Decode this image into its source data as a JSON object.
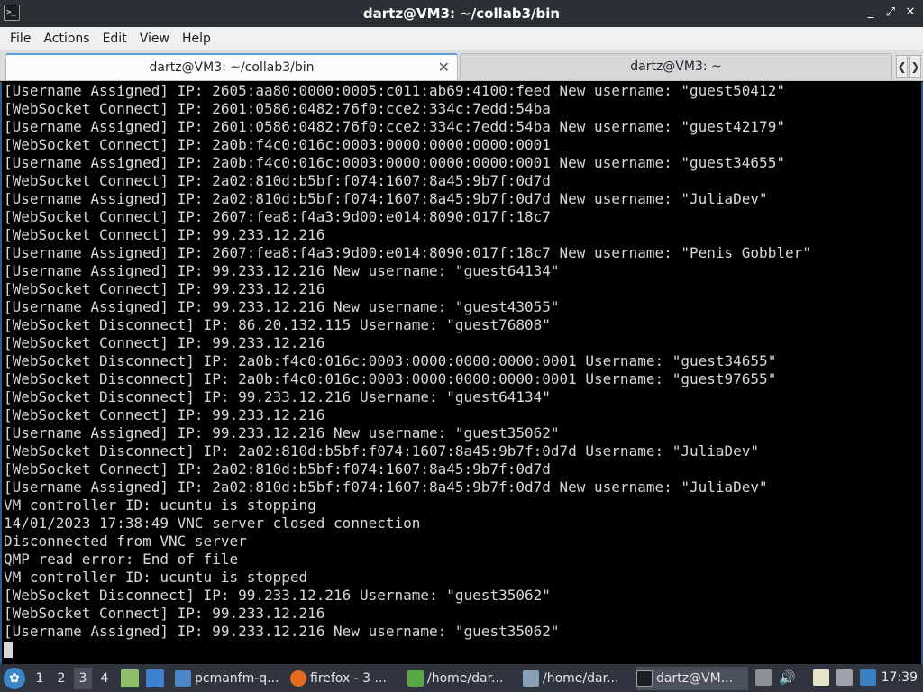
{
  "window": {
    "title": "dartz@VM3: ~/collab3/bin",
    "app_icon": ">_",
    "buttons": [
      "_",
      "⤢",
      "✕"
    ]
  },
  "menu": [
    "File",
    "Actions",
    "Edit",
    "View",
    "Help"
  ],
  "tabs": [
    {
      "label": "dartz@VM3: ~/collab3/bin",
      "active": true
    },
    {
      "label": "dartz@VM3: ~",
      "active": false
    }
  ],
  "terminal": {
    "lines": [
      "[Username Assigned] IP: 2605:aa80:0000:0005:c011:ab69:4100:feed New username: \"guest50412\"",
      "[WebSocket Connect] IP: 2601:0586:0482:76f0:cce2:334c:7edd:54ba",
      "[Username Assigned] IP: 2601:0586:0482:76f0:cce2:334c:7edd:54ba New username: \"guest42179\"",
      "[WebSocket Connect] IP: 2a0b:f4c0:016c:0003:0000:0000:0000:0001",
      "[Username Assigned] IP: 2a0b:f4c0:016c:0003:0000:0000:0000:0001 New username: \"guest34655\"",
      "[WebSocket Connect] IP: 2a02:810d:b5bf:f074:1607:8a45:9b7f:0d7d",
      "[Username Assigned] IP: 2a02:810d:b5bf:f074:1607:8a45:9b7f:0d7d New username: \"JuliaDev\"",
      "[WebSocket Connect] IP: 2607:fea8:f4a3:9d00:e014:8090:017f:18c7",
      "[WebSocket Connect] IP: 99.233.12.216",
      "[Username Assigned] IP: 2607:fea8:f4a3:9d00:e014:8090:017f:18c7 New username: \"Penis Gobbler\"",
      "[Username Assigned] IP: 99.233.12.216 New username: \"guest64134\"",
      "[WebSocket Connect] IP: 99.233.12.216",
      "[Username Assigned] IP: 99.233.12.216 New username: \"guest43055\"",
      "[WebSocket Disconnect] IP: 86.20.132.115 Username: \"guest76808\"",
      "[WebSocket Connect] IP: 99.233.12.216",
      "[WebSocket Disconnect] IP: 2a0b:f4c0:016c:0003:0000:0000:0000:0001 Username: \"guest34655\"",
      "[WebSocket Disconnect] IP: 2a0b:f4c0:016c:0003:0000:0000:0000:0001 Username: \"guest97655\"",
      "[WebSocket Disconnect] IP: 99.233.12.216 Username: \"guest64134\"",
      "[WebSocket Connect] IP: 99.233.12.216",
      "[Username Assigned] IP: 99.233.12.216 New username: \"guest35062\"",
      "[WebSocket Disconnect] IP: 2a02:810d:b5bf:f074:1607:8a45:9b7f:0d7d Username: \"JuliaDev\"",
      "[WebSocket Connect] IP: 2a02:810d:b5bf:f074:1607:8a45:9b7f:0d7d",
      "[Username Assigned] IP: 2a02:810d:b5bf:f074:1607:8a45:9b7f:0d7d New username: \"JuliaDev\"",
      "VM controller ID: ucuntu is stopping",
      "14/01/2023 17:38:49 VNC server closed connection",
      "Disconnected from VNC server",
      "QMP read error: End of file",
      "VM controller ID: ucuntu is stopped",
      "[WebSocket Disconnect] IP: 99.233.12.216 Username: \"guest35062\"",
      "[WebSocket Connect] IP: 99.233.12.216",
      "[Username Assigned] IP: 99.233.12.216 New username: \"guest35062\""
    ]
  },
  "taskbar": {
    "desktops": [
      "1",
      "2",
      "3",
      "4"
    ],
    "current_desktop": "3",
    "tasks": [
      {
        "label": "pcmanfm-q...",
        "icon": "folder-icon"
      },
      {
        "label": "firefox - 3 ...",
        "icon": "firefox-icon"
      },
      {
        "label": "/home/dar...",
        "icon": "text-editor-icon"
      },
      {
        "label": "/home/dar...",
        "icon": "editor-icon"
      },
      {
        "label": "dartz@VM...",
        "icon": "terminal-icon"
      }
    ],
    "clock": "17:39"
  }
}
